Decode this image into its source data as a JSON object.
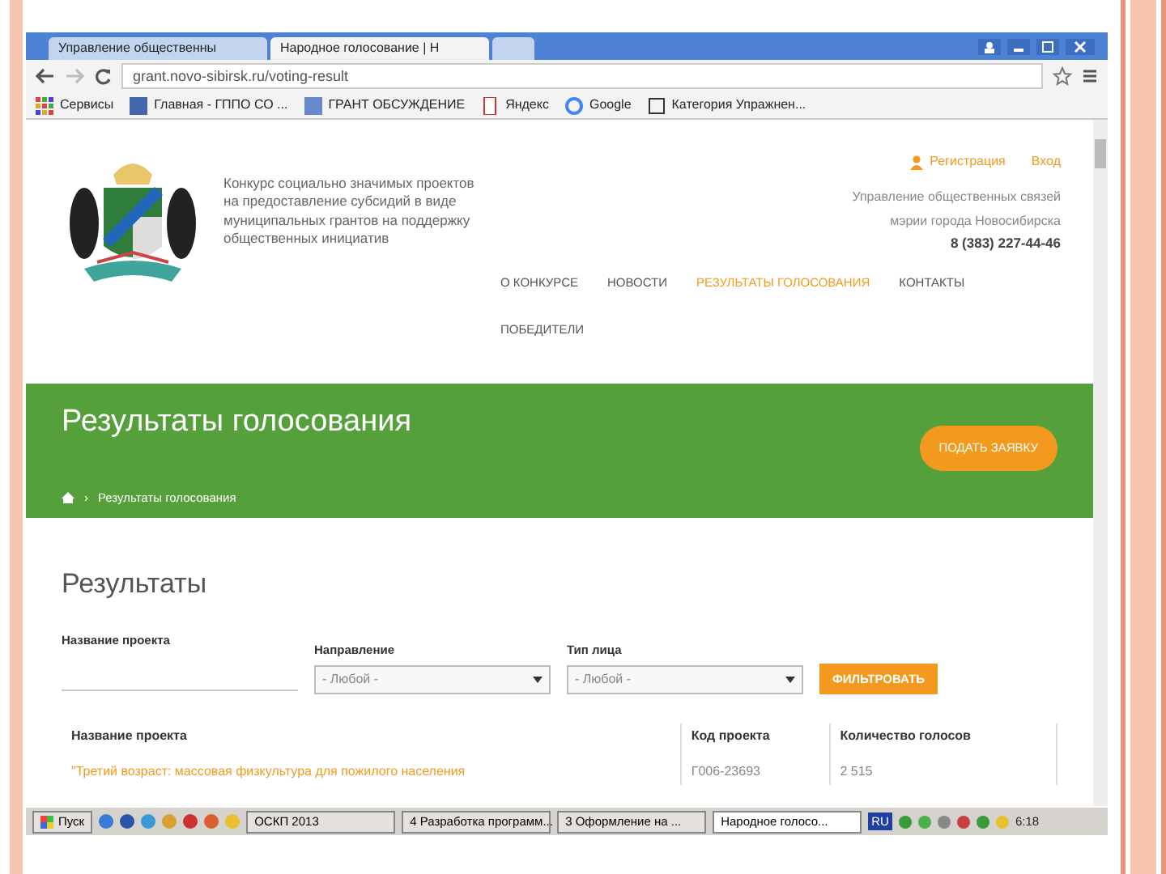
{
  "browser": {
    "tabs": [
      {
        "title": "Управление общественны",
        "selected": false
      },
      {
        "title": "Народное голосование | Н",
        "selected": true
      }
    ],
    "address": "grant.novo-sibirsk.ru/voting-result",
    "bookmarks": [
      "Сервисы",
      "Главная - ГППО СО ...",
      "ГРАНТ ОБСУЖДЕНИЕ",
      "Яндекс",
      "Google",
      "Категория Упражнен..."
    ]
  },
  "header": {
    "description": "Конкурс социально значимых проектов на предоставление субсидий в виде муниципальных грантов на поддержку общественных инициатив",
    "auth_links": [
      "Регистрация",
      "Вход"
    ],
    "org_lines": [
      "Управление общественных связей",
      "мэрии города Новосибирска"
    ],
    "phone": "8 (383) 227-44-46",
    "nav": [
      {
        "label": "О КОНКУРСЕ",
        "selected": false
      },
      {
        "label": "НОВОСТИ",
        "selected": false
      },
      {
        "label": "РЕЗУЛЬТАТЫ ГОЛОСОВАНИЯ",
        "selected": true
      },
      {
        "label": "КОНТАКТЫ",
        "selected": false
      },
      {
        "label": "ПОБЕДИТЕЛИ",
        "selected": false
      }
    ]
  },
  "banner": {
    "title": "Результаты голосования",
    "button": "ПОДАТЬ ЗАЯВКУ",
    "breadcrumb_separator": "›",
    "breadcrumb": "Результаты голосования"
  },
  "results": {
    "title": "Результаты",
    "filters": [
      {
        "kind": "text",
        "label": "Название проекта"
      },
      {
        "kind": "select",
        "label": "Направление",
        "value": "- Любой -"
      },
      {
        "kind": "select",
        "label": "Тип лица",
        "value": "- Любой -"
      }
    ],
    "filter_button": "ФИЛЬТРОВАТЬ",
    "table": {
      "columns": [
        "Название проекта",
        "Код проекта",
        "Количество голосов"
      ],
      "rows": [
        [
          "\"Третий возраст: массовая физкультура для пожилого населения",
          "Г006-23693",
          "2 515"
        ]
      ]
    }
  },
  "taskbar": {
    "start": "Пуск",
    "tasks": [
      {
        "label": "ОСКП 2013",
        "selected": false
      },
      {
        "label": "4 Разработка программ...",
        "selected": false
      },
      {
        "label": "3 Оформление на ...",
        "selected": false
      },
      {
        "label": "Народное голосо...",
        "selected": true
      }
    ],
    "language": "RU",
    "time": "6:18"
  }
}
